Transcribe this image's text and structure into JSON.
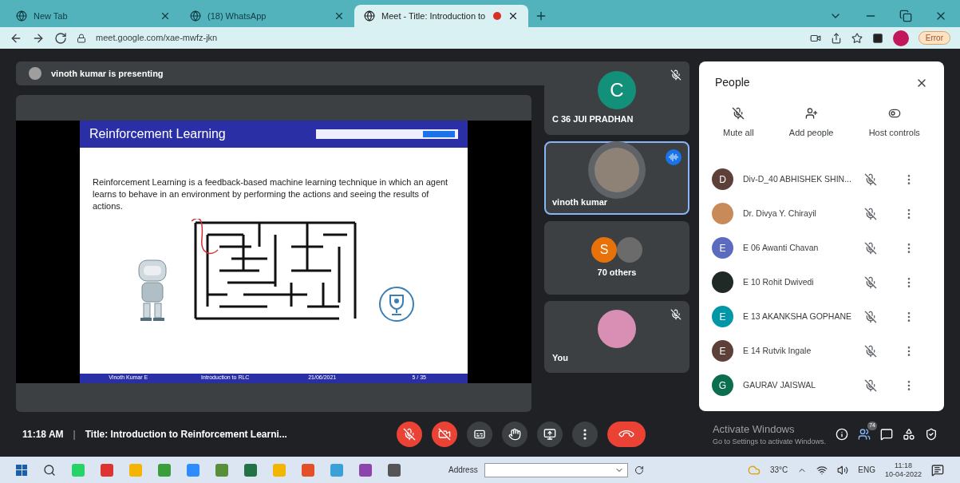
{
  "browser": {
    "tabs": [
      {
        "label": "New Tab",
        "selected": false
      },
      {
        "label": "(18) WhatsApp",
        "selected": false
      },
      {
        "label": "Meet - Title: Introduction to",
        "selected": true,
        "recording": true
      }
    ],
    "url": "meet.google.com/xae-mwfz-jkn",
    "profile_button": "Error"
  },
  "banner": {
    "text": "vinoth kumar is presenting"
  },
  "slide": {
    "title": "Reinforcement Learning",
    "body": "Reinforcement Learning is a feedback-based machine learning technique in which an agent learns to behave in an environment by performing the actions and seeing the results of actions.",
    "footer": [
      "Vinoth Kumar E",
      "Introduction to RLC",
      "21/06/2021",
      "5 / 35"
    ]
  },
  "tiles": [
    {
      "kind": "letter",
      "avatar": "C",
      "color": "#12907a",
      "name": "C 36 JUI PRADHAN",
      "muted": true,
      "speaking": false
    },
    {
      "kind": "photo",
      "name": "vinoth kumar",
      "muted": false,
      "speaking": true
    },
    {
      "kind": "group",
      "avatar": "S",
      "color": "#e8710a",
      "name": "70 others",
      "muted": false,
      "speaking": false
    },
    {
      "kind": "flower",
      "name": "You",
      "muted": true,
      "speaking": false
    }
  ],
  "people": {
    "title": "People",
    "actions": [
      "Mute all",
      "Add people",
      "Host controls"
    ],
    "participants": [
      {
        "name": "Div-D_40 ABHISHEK SHIN...",
        "avatar": "D",
        "color": "#5d4037"
      },
      {
        "name": "Dr. Divya Y. Chirayil",
        "color": "#c98a5a"
      },
      {
        "name": "E 06 Awanti Chavan",
        "avatar": "E",
        "color": "#5c6bc0"
      },
      {
        "name": "E 10 Rohit Dwivedi",
        "color": "#1f2a26"
      },
      {
        "name": "E 13 AKANKSHA GOPHANE",
        "avatar": "E",
        "color": "#0097a7"
      },
      {
        "name": "E 14 Rutvik Ingale",
        "avatar": "E",
        "color": "#5d4037"
      },
      {
        "name": "GAURAV JAISWAL",
        "avatar": "G",
        "color": "#0b6e4f"
      }
    ]
  },
  "bottom": {
    "time": "11:18 AM",
    "separator": "|",
    "title": "Title: Introduction to Reinforcement Learni...",
    "people_count": "74",
    "activation": [
      "Activate Windows",
      "Go to Settings to activate Windows."
    ]
  },
  "taskbar": {
    "address_label": "Address",
    "weather": "33°C",
    "language": "ENG",
    "clock_time": "11:18",
    "clock_date": "10-04-2022"
  }
}
